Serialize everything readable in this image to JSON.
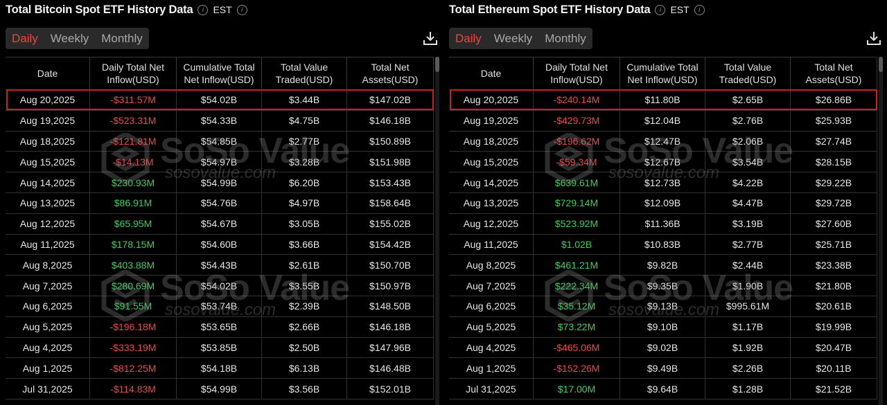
{
  "tabs": [
    "Daily",
    "Weekly",
    "Monthly"
  ],
  "timezone": "EST",
  "headers": [
    "Date",
    "Daily Total Net Inflow(USD)",
    "Cumulative Total Net Inflow(USD)",
    "Total Value Traded(USD)",
    "Total Net Assets(USD)"
  ],
  "watermark": {
    "brand": "SoSo Value",
    "url": "sosovalue.com"
  },
  "colors": {
    "negative": "#ea4a4a",
    "positive": "#3ccf5a",
    "active_tab": "#e8493c",
    "highlight": "#d01e1e"
  },
  "btc": {
    "title": "Total Bitcoin Spot ETF History Data",
    "rows": [
      [
        "Aug 20,2025",
        "-$311.57M",
        "$54.02B",
        "$3.44B",
        "$147.02B"
      ],
      [
        "Aug 19,2025",
        "-$523.31M",
        "$54.33B",
        "$4.75B",
        "$146.18B"
      ],
      [
        "Aug 18,2025",
        "-$121.81M",
        "$54.85B",
        "$2.77B",
        "$150.89B"
      ],
      [
        "Aug 15,2025",
        "-$14.13M",
        "$54.97B",
        "$3.28B",
        "$151.98B"
      ],
      [
        "Aug 14,2025",
        "$230.93M",
        "$54.99B",
        "$6.20B",
        "$153.43B"
      ],
      [
        "Aug 13,2025",
        "$86.91M",
        "$54.76B",
        "$4.97B",
        "$158.64B"
      ],
      [
        "Aug 12,2025",
        "$65.95M",
        "$54.67B",
        "$3.05B",
        "$155.02B"
      ],
      [
        "Aug 11,2025",
        "$178.15M",
        "$54.60B",
        "$3.66B",
        "$154.42B"
      ],
      [
        "Aug 8,2025",
        "$403.88M",
        "$54.43B",
        "$2.61B",
        "$150.70B"
      ],
      [
        "Aug 7,2025",
        "$280.69M",
        "$54.02B",
        "$3.55B",
        "$150.97B"
      ],
      [
        "Aug 6,2025",
        "$91.55M",
        "$53.74B",
        "$2.39B",
        "$148.50B"
      ],
      [
        "Aug 5,2025",
        "-$196.18M",
        "$53.65B",
        "$2.66B",
        "$146.18B"
      ],
      [
        "Aug 4,2025",
        "-$333.19M",
        "$53.85B",
        "$2.50B",
        "$147.96B"
      ],
      [
        "Aug 1,2025",
        "-$812.25M",
        "$54.18B",
        "$6.13B",
        "$146.48B"
      ],
      [
        "Jul 31,2025",
        "-$114.83M",
        "$54.99B",
        "$3.56B",
        "$152.01B"
      ]
    ]
  },
  "eth": {
    "title": "Total Ethereum Spot ETF History Data",
    "rows": [
      [
        "Aug 20,2025",
        "-$240.14M",
        "$11.80B",
        "$2.65B",
        "$26.86B"
      ],
      [
        "Aug 19,2025",
        "-$429.73M",
        "$12.04B",
        "$2.76B",
        "$25.93B"
      ],
      [
        "Aug 18,2025",
        "-$196.62M",
        "$12.47B",
        "$2.06B",
        "$27.74B"
      ],
      [
        "Aug 15,2025",
        "-$59.34M",
        "$12.67B",
        "$3.54B",
        "$28.15B"
      ],
      [
        "Aug 14,2025",
        "$639.61M",
        "$12.73B",
        "$4.22B",
        "$29.22B"
      ],
      [
        "Aug 13,2025",
        "$729.14M",
        "$12.09B",
        "$4.47B",
        "$29.72B"
      ],
      [
        "Aug 12,2025",
        "$523.92M",
        "$11.36B",
        "$3.19B",
        "$27.60B"
      ],
      [
        "Aug 11,2025",
        "$1.02B",
        "$10.83B",
        "$2.77B",
        "$25.71B"
      ],
      [
        "Aug 8,2025",
        "$461.21M",
        "$9.82B",
        "$2.44B",
        "$23.38B"
      ],
      [
        "Aug 7,2025",
        "$222.34M",
        "$9.35B",
        "$1.90B",
        "$21.80B"
      ],
      [
        "Aug 6,2025",
        "$35.12M",
        "$9.13B",
        "$995.61M",
        "$20.61B"
      ],
      [
        "Aug 5,2025",
        "$73.22M",
        "$9.10B",
        "$1.17B",
        "$19.99B"
      ],
      [
        "Aug 4,2025",
        "-$465.06M",
        "$9.02B",
        "$1.92B",
        "$20.47B"
      ],
      [
        "Aug 1,2025",
        "-$152.26M",
        "$9.49B",
        "$2.26B",
        "$20.11B"
      ],
      [
        "Jul 31,2025",
        "$17.00M",
        "$9.64B",
        "$1.28B",
        "$21.52B"
      ]
    ]
  }
}
